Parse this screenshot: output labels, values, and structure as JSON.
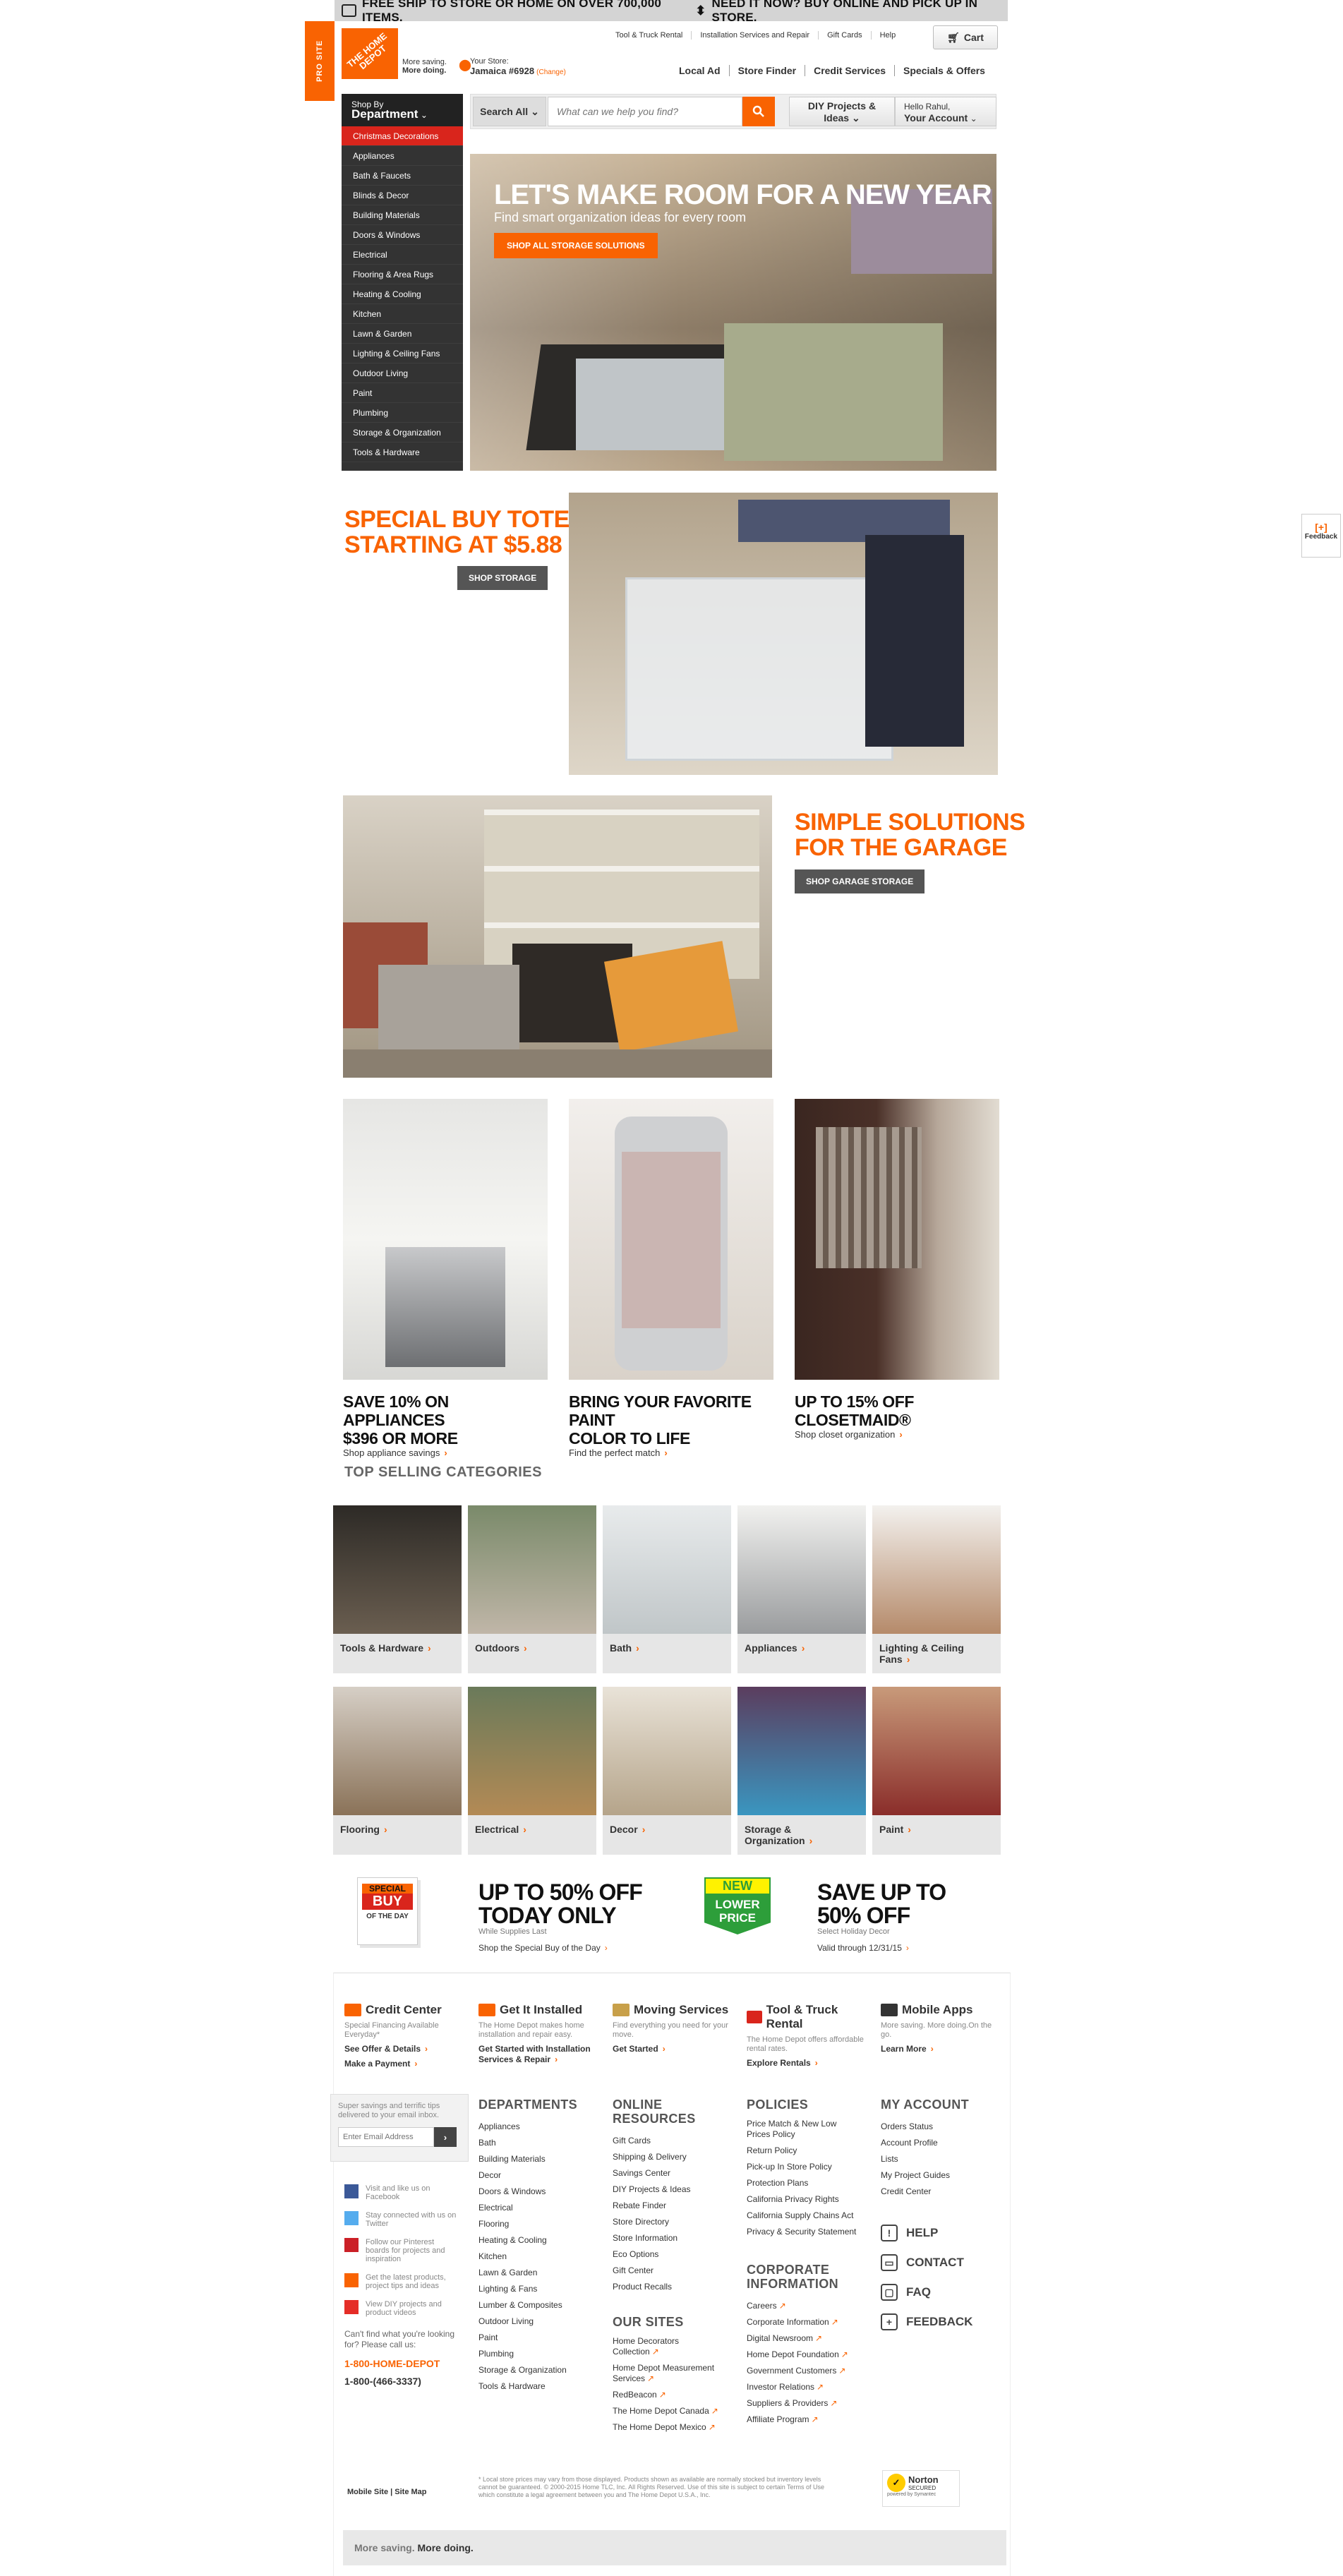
{
  "promo": {
    "text1": "FREE SHIP TO STORE OR HOME ON OVER 700,000 ITEMS.",
    "text2": "NEED IT NOW? BUY ONLINE AND PICK UP IN STORE."
  },
  "pro_tab": "PRO SITE",
  "logo": {
    "text": "THE HOME DEPOT",
    "tag1": "More saving.",
    "tag2": "More doing."
  },
  "top_nav": [
    "Tool & Truck Rental",
    "Installation Services and Repair",
    "Gift Cards",
    "Help"
  ],
  "cart": "Cart",
  "store": {
    "label": "Your Store:",
    "name": "Jamaica #6928",
    "change": "(Change)"
  },
  "sec_nav": [
    "Local Ad",
    "Store Finder",
    "Credit Services",
    "Specials & Offers"
  ],
  "dept": {
    "shop_by": "Shop By",
    "title": "Department",
    "items": [
      "Christmas Decorations",
      "Appliances",
      "Bath & Faucets",
      "Blinds & Decor",
      "Building Materials",
      "Doors & Windows",
      "Electrical",
      "Flooring & Area Rugs",
      "Heating & Cooling",
      "Kitchen",
      "Lawn & Garden",
      "Lighting & Ceiling Fans",
      "Outdoor Living",
      "Paint",
      "Plumbing",
      "Storage & Organization",
      "Tools & Hardware"
    ]
  },
  "search": {
    "category": "Search All",
    "placeholder": "What can we help you find?"
  },
  "diy": {
    "line1": "DIY Projects &",
    "line2": "Ideas"
  },
  "account": {
    "hello": "Hello Rahul,",
    "label": "Your Account"
  },
  "hero": {
    "title": "LET'S MAKE ROOM FOR A NEW YEAR",
    "subtitle": "Find smart organization ideas for every room",
    "button": "SHOP ALL STORAGE SOLUTIONS"
  },
  "totes": {
    "line1": "SPECIAL BUY TOTES",
    "line2": "STARTING AT $5.88",
    "button": "SHOP STORAGE"
  },
  "garage": {
    "line1": "SIMPLE SOLUTIONS",
    "line2": "FOR THE GARAGE",
    "button": "SHOP GARAGE STORAGE"
  },
  "cards": [
    {
      "line1": "SAVE 10% ON APPLIANCES",
      "line2": "$396 OR MORE",
      "link": "Shop appliance savings"
    },
    {
      "line1": "BRING YOUR FAVORITE PAINT",
      "line2": "COLOR TO LIFE",
      "link": "Find the perfect match"
    },
    {
      "line1": "UP TO 15% OFF",
      "line2": "CLOSETMAID®",
      "link": "Shop closet organization"
    }
  ],
  "top_selling": {
    "title": "TOP SELLING CATEGORIES",
    "row1": [
      "Tools & Hardware",
      "Outdoors",
      "Bath",
      "Appliances",
      "Lighting & Ceiling Fans"
    ],
    "row2": [
      "Flooring",
      "Electrical",
      "Decor",
      "Storage & Organization",
      "Paint"
    ]
  },
  "deals": {
    "special_badge": {
      "a": "SPECIAL",
      "b": "BUY",
      "c": "OF THE DAY"
    },
    "d1": {
      "line1": "UP TO 50% OFF",
      "line2": "TODAY ONLY",
      "small": "While Supplies Last",
      "link": "Shop the Special Buy of the Day"
    },
    "lower_badge": {
      "a": "NEW",
      "b": "LOWER",
      "c": "PRICE"
    },
    "d2": {
      "line1": "SAVE UP TO",
      "line2": "50% OFF",
      "small": "Select Holiday Decor",
      "link": "Valid through 12/31/15"
    }
  },
  "services": [
    {
      "title": "Credit Center",
      "sub": "Special Financing Available Everyday*",
      "l1": "See Offer & Details",
      "l2": "Make a Payment"
    },
    {
      "title": "Get It Installed",
      "sub": "The Home Depot makes home installation and repair easy.",
      "l1": "Get Started with Installation Services & Repair",
      "l2": ""
    },
    {
      "title": "Moving Services",
      "sub": "Find everything you need for your move.",
      "l1": "Get Started",
      "l2": ""
    },
    {
      "title": "Tool & Truck Rental",
      "sub": "The Home Depot offers affordable rental rates.",
      "l1": "Explore Rentals",
      "l2": ""
    },
    {
      "title": "Mobile Apps",
      "sub": "More saving. More doing.On the go.",
      "l1": "Learn More",
      "l2": ""
    }
  ],
  "email": {
    "text": "Super savings and terrific tips delivered to your email inbox.",
    "placeholder": "Enter Email Address"
  },
  "social": [
    "Visit and like us on Facebook",
    "Stay connected with us on Twitter",
    "Follow our Pinterest boards for projects and inspiration",
    "Get the latest products, project tips and ideas",
    "View DIY projects and product videos"
  ],
  "phone": {
    "q": "Can't find what you're looking for? Please call us:",
    "n1": "1-800-HOME-DEPOT",
    "n2": "1-800-(466-3337)"
  },
  "departments": {
    "title": "DEPARTMENTS",
    "items": [
      "Appliances",
      "Bath",
      "Building Materials",
      "Decor",
      "Doors & Windows",
      "Electrical",
      "Flooring",
      "Heating & Cooling",
      "Kitchen",
      "Lawn & Garden",
      "Lighting & Fans",
      "Lumber & Composites",
      "Outdoor Living",
      "Paint",
      "Plumbing",
      "Storage & Organization",
      "Tools & Hardware"
    ]
  },
  "online": {
    "title1": "ONLINE",
    "title2": "RESOURCES",
    "items": [
      "Gift Cards",
      "Shipping & Delivery",
      "Savings Center",
      "DIY Projects & Ideas",
      "Rebate Finder",
      "Store Directory",
      "Store Information",
      "Eco Options",
      "Gift Center",
      "Product Recalls"
    ]
  },
  "our_sites": {
    "title": "OUR SITES",
    "items": [
      "Home Decorators Collection",
      "Home Depot Measurement Services",
      "RedBeacon",
      "The Home Depot Canada",
      "The Home Depot Mexico"
    ]
  },
  "policies": {
    "title": "POLICIES",
    "items": [
      "Price Match & New Low Prices Policy",
      "Return Policy",
      "Pick-up In Store Policy",
      "Protection Plans",
      "California Privacy Rights",
      "California Supply Chains Act",
      "Privacy & Security Statement"
    ]
  },
  "corporate": {
    "title1": "CORPORATE",
    "title2": "INFORMATION",
    "items": [
      "Careers",
      "Corporate Information",
      "Digital Newsroom",
      "Home Depot Foundation",
      "Government Customers",
      "Investor Relations",
      "Suppliers & Providers",
      "Affiliate Program"
    ]
  },
  "my_account": {
    "title": "MY ACCOUNT",
    "items": [
      "Orders Status",
      "Account Profile",
      "Lists",
      "My Project Guides",
      "Credit Center"
    ]
  },
  "help_links": [
    "HELP",
    "CONTACT",
    "FAQ",
    "FEEDBACK"
  ],
  "bottom": {
    "mobile": "Mobile Site",
    "sitemap": "Site Map",
    "legal": "* Local store prices may vary from those displayed. Products shown as available are normally stocked but inventory levels cannot be guaranteed. © 2000-2015 Home TLC, Inc. All Rights Reserved. Use of this site is subject to certain Terms of Use which constitute a legal agreement between you and The Home Depot U.S.A., Inc.",
    "norton": "Norton",
    "secured": "SECURED",
    "symantec": "powered by Symantec",
    "slogan1": "More saving.",
    "slogan2": "More doing."
  },
  "feedback": {
    "icon": "[+]",
    "label": "Feedback"
  },
  "colors": {
    "orange": "#f96302",
    "dark": "#333333",
    "red": "#d9251c"
  }
}
